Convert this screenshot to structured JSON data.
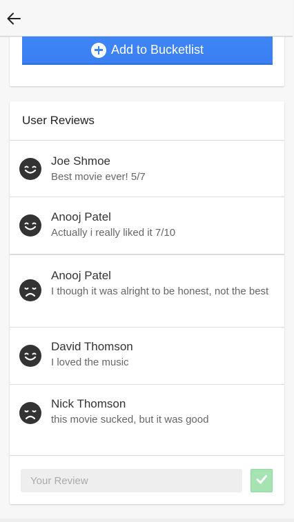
{
  "header": {
    "back_icon": "arrow-left-icon"
  },
  "actions": {
    "add_label": "Add to Bucketlist",
    "add_icon": "plus-circle-icon",
    "accent_color": "#3b82f6"
  },
  "reviews": {
    "title": "User Reviews",
    "items": [
      {
        "name": "Joe Shmoe",
        "text": "Best movie ever! 5/7",
        "mood": "happy"
      },
      {
        "name": "Anooj Patel",
        "text": "Actually i really liked it 7/10",
        "mood": "happy"
      },
      {
        "name": "Anooj Patel",
        "text": "I though it was alright to be honest, not the best",
        "mood": "sad"
      },
      {
        "name": "David Thomson",
        "text": "I loved the music",
        "mood": "happy"
      },
      {
        "name": "Nick Thomson",
        "text": "this movie sucked, but it was good",
        "mood": "sad"
      }
    ],
    "input_placeholder": "Your Review",
    "submit_icon": "checkmark-icon",
    "submit_color": "#a6e3b3"
  }
}
